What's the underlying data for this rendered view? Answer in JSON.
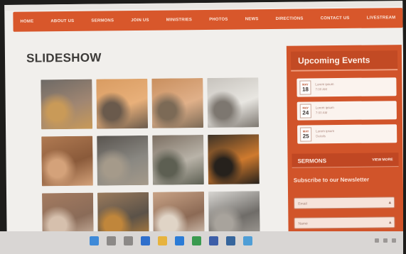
{
  "nav": {
    "items": [
      "HOME",
      "ABOUT US",
      "SERMONS",
      "JOIN US",
      "MINISTRIES",
      "PHOTOS",
      "NEWS",
      "DIRECTIONS",
      "CONTACT US",
      "LIVESTREAM"
    ]
  },
  "page": {
    "title": "SLIDESHOW"
  },
  "gallery": {
    "photos": [
      {
        "icon": "photo-icon",
        "colors": [
          "#6e6a66",
          "#a08672",
          "#c99a58"
        ]
      },
      {
        "icon": "photo-icon",
        "colors": [
          "#d99c62",
          "#e8b07a",
          "#6a5a4c"
        ]
      },
      {
        "icon": "photo-icon",
        "colors": [
          "#c98f5e",
          "#e0b089",
          "#7c6a56"
        ]
      },
      {
        "icon": "photo-icon",
        "colors": [
          "#c7c3bd",
          "#e8e6e1",
          "#7d7770"
        ]
      },
      {
        "icon": "photo-icon",
        "colors": [
          "#b07a52",
          "#8a5a3a",
          "#d4a27a"
        ]
      },
      {
        "icon": "photo-icon",
        "colors": [
          "#59544f",
          "#8a8882",
          "#a59a8a"
        ]
      },
      {
        "icon": "photo-icon",
        "colors": [
          "#7c6f62",
          "#b9b3a8",
          "#5d5f52"
        ]
      },
      {
        "icon": "photo-icon",
        "colors": [
          "#3c3227",
          "#cf7a2e",
          "#26211c"
        ]
      },
      {
        "icon": "photo-icon",
        "colors": [
          "#a47b60",
          "#8a6b58",
          "#d6c0ad"
        ]
      },
      {
        "icon": "photo-icon",
        "colors": [
          "#9a7a5c",
          "#5b5248",
          "#c0863b"
        ]
      },
      {
        "icon": "photo-icon",
        "colors": [
          "#c9a386",
          "#8c6a55",
          "#e0d4c6"
        ]
      },
      {
        "icon": "photo-icon",
        "colors": [
          "#d8d6d2",
          "#6f6c68",
          "#a8a39c"
        ]
      }
    ]
  },
  "sidebar": {
    "events_title": "Upcoming Events",
    "events": [
      {
        "month": "MAY",
        "day": "18",
        "name": "Lorem ipsum",
        "time": "7:00 AM"
      },
      {
        "month": "MAY",
        "day": "24",
        "name": "Lorem ipsum",
        "time": "7:00 AM"
      },
      {
        "month": "MAY",
        "day": "25",
        "name": "Lorem ipsum",
        "time": "Details"
      }
    ],
    "sermons_label": "SERMONS",
    "view_more": "VIEW MORE",
    "newsletter_heading": "Subscribe to our Newsletter",
    "fields": [
      {
        "placeholder": "Email",
        "arrow": "▴"
      },
      {
        "placeholder": "Name",
        "arrow": "▴"
      },
      {
        "placeholder": "",
        "arrow": "▴"
      }
    ]
  },
  "taskbar": {
    "left_text": "",
    "icons": [
      {
        "name": "start-icon",
        "color": "#3f8ad8"
      },
      {
        "name": "search-icon",
        "color": "#8c8987"
      },
      {
        "name": "taskview-icon",
        "color": "#8c8987"
      },
      {
        "name": "dropbox-icon",
        "color": "#2f6fcc"
      },
      {
        "name": "explorer-icon",
        "color": "#e7b33e"
      },
      {
        "name": "edge-icon",
        "color": "#2b7bd6"
      },
      {
        "name": "chrome-icon",
        "color": "#3a9a4f"
      },
      {
        "name": "store-icon",
        "color": "#3d5ea8"
      },
      {
        "name": "mail-icon",
        "color": "#36659c"
      },
      {
        "name": "app-icon",
        "color": "#4f9ed6"
      }
    ]
  },
  "colors": {
    "accent": "#d8572b",
    "sidebar": "#d1542a",
    "page_bg": "#f1efec"
  }
}
